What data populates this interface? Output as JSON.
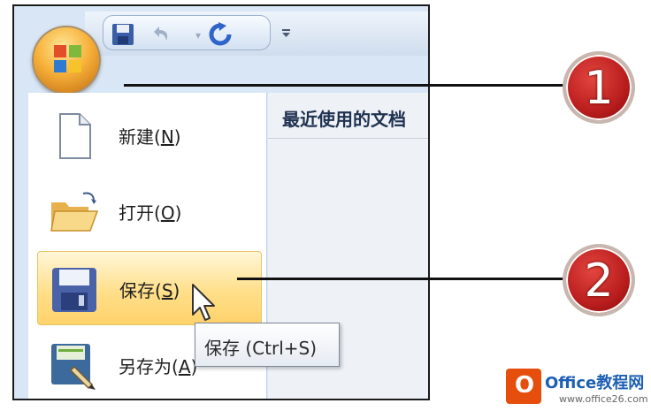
{
  "quick_access": {
    "save_icon": "save-icon",
    "undo_icon": "undo-icon",
    "redo_icon": "redo-icon",
    "dropdown_icon": "customize-dropdown-icon"
  },
  "office_button": {
    "icon": "office-logo-icon"
  },
  "menu": {
    "items": [
      {
        "label": "新建(",
        "accel": "N",
        "label_end": ")",
        "icon": "new-document-icon"
      },
      {
        "label": "打开(",
        "accel": "O",
        "label_end": ")",
        "icon": "open-folder-icon"
      },
      {
        "label": "保存(",
        "accel": "S",
        "label_end": ")",
        "icon": "save-disk-icon"
      },
      {
        "label": "另存为(",
        "accel": "A",
        "label_end": ")",
        "icon": "save-as-icon"
      }
    ],
    "recent_title": "最近使用的文档"
  },
  "tooltip": {
    "text": "保存 (Ctrl+S)"
  },
  "callouts": [
    "1",
    "2"
  ],
  "watermark": {
    "brand": "Office教程网",
    "url": "www.office26.com"
  },
  "colors": {
    "hover_highlight": "#ffdf8a",
    "callout_red": "#b81c1c",
    "orb_orange": "#f7b23a"
  }
}
